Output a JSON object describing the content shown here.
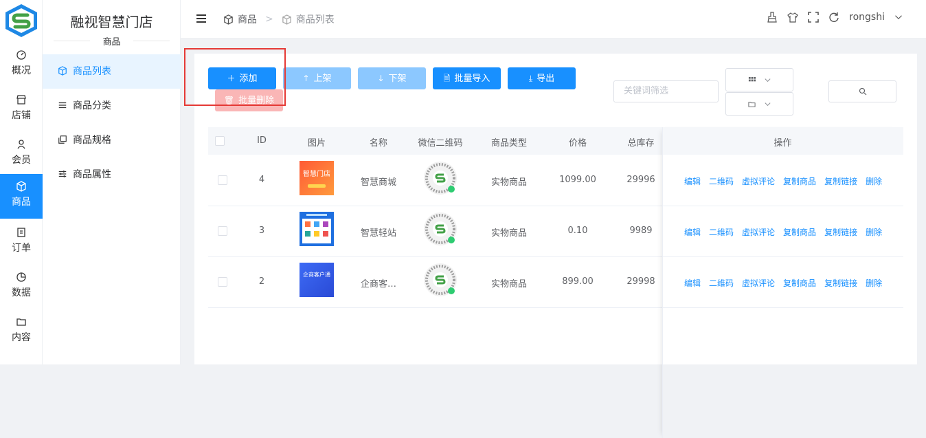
{
  "app": {
    "brand": "融视智慧门店",
    "section_title": "商品"
  },
  "rail": [
    {
      "label": "概况",
      "icon": "dashboard-icon"
    },
    {
      "label": "店铺",
      "icon": "store-icon"
    },
    {
      "label": "会员",
      "icon": "user-icon"
    },
    {
      "label": "商品",
      "icon": "box-icon",
      "active": true
    },
    {
      "label": "订单",
      "icon": "clipboard-icon"
    },
    {
      "label": "数据",
      "icon": "pie-icon"
    },
    {
      "label": "内容",
      "icon": "folder-icon"
    }
  ],
  "submenu": [
    {
      "label": "商品列表",
      "icon": "box-icon",
      "active": true
    },
    {
      "label": "商品分类",
      "icon": "list-icon"
    },
    {
      "label": "商品规格",
      "icon": "copy-icon"
    },
    {
      "label": "商品属性",
      "icon": "sliders-icon"
    }
  ],
  "breadcrumb": {
    "root": "商品",
    "separator": ">",
    "current": "商品列表"
  },
  "header": {
    "username": "rongshi"
  },
  "toolbar": {
    "add": "添加",
    "shelve": "上架",
    "unshelve": "下架",
    "batch_import": "批量导入",
    "export": "导出",
    "batch_delete": "批量删除"
  },
  "filters": {
    "keyword_placeholder": "关键词筛选"
  },
  "table": {
    "headers": {
      "id": "ID",
      "image": "图片",
      "name": "名称",
      "qr": "微信二维码",
      "type": "商品类型",
      "price": "价格",
      "stock": "总库存",
      "ops": "操作"
    },
    "rows": [
      {
        "id": "4",
        "name": "智慧商城",
        "type": "实物商品",
        "price": "1099.00",
        "stock": "29996",
        "thumb_text": "智慧门店"
      },
      {
        "id": "3",
        "name": "智慧轻站",
        "type": "实物商品",
        "price": "0.10",
        "stock": "9989",
        "thumb_text": ""
      },
      {
        "id": "2",
        "name": "企商客…",
        "type": "实物商品",
        "price": "899.00",
        "stock": "29998",
        "thumb_text": "企商客户通"
      }
    ],
    "actions": [
      "编辑",
      "二维码",
      "虚拟评论",
      "复制商品",
      "复制链接",
      "删除"
    ]
  },
  "colors": {
    "primary": "#1890ff",
    "disabled": "#8cc8ff",
    "danger_disabled": "#fab6b6",
    "highlight": "#e53935"
  }
}
